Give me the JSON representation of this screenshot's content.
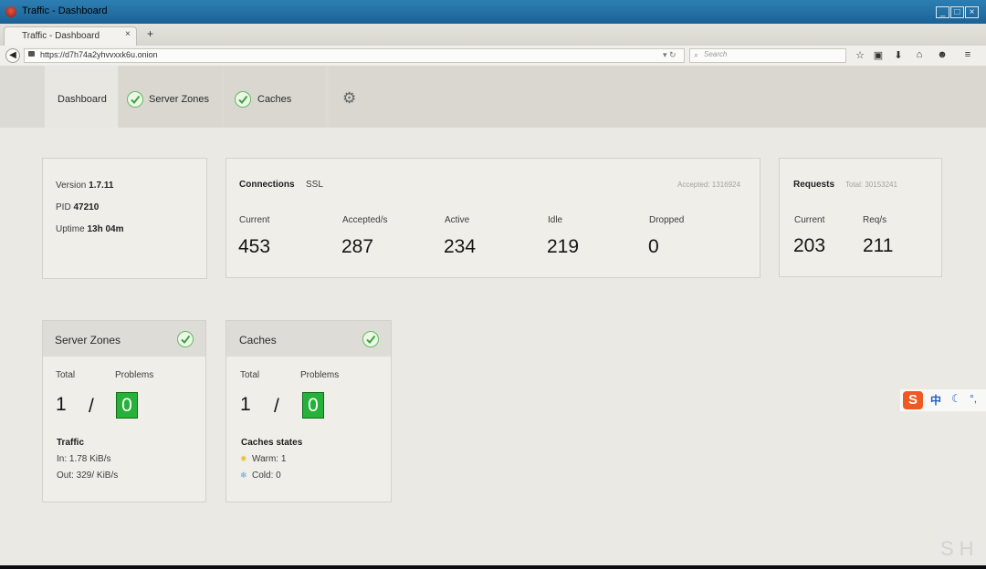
{
  "window": {
    "title": "Traffic - Dashboard"
  },
  "browser": {
    "tab_title": "Traffic - Dashboard",
    "close_glyph": "×",
    "new_tab_glyph": "+",
    "url": "https://d7h74a2yhvvxxk6u.onion",
    "search_placeholder": "Search"
  },
  "nav": {
    "tabs": [
      {
        "label": "Dashboard",
        "active": true
      },
      {
        "label": "Server Zones",
        "status": "ok"
      },
      {
        "label": "Caches",
        "status": "ok"
      }
    ]
  },
  "info": {
    "version_label": "Version",
    "version_value": "1.7.11",
    "pid_label": "PID",
    "pid_value": "47210",
    "uptime_label": "Uptime",
    "uptime_value": "13h 04m"
  },
  "connections": {
    "title": "Connections",
    "ssl_label": "SSL",
    "accepted_total": "Accepted: 1316924",
    "metrics": [
      {
        "label": "Current",
        "value": "453"
      },
      {
        "label": "Accepted/s",
        "value": "287"
      },
      {
        "label": "Active",
        "value": "234"
      },
      {
        "label": "Idle",
        "value": "219"
      },
      {
        "label": "Dropped",
        "value": "0"
      }
    ]
  },
  "requests": {
    "title": "Requests",
    "total": "Total: 30153241",
    "metrics": [
      {
        "label": "Current",
        "value": "203"
      },
      {
        "label": "Req/s",
        "value": "211"
      }
    ]
  },
  "server_zones": {
    "title": "Server Zones",
    "total_label": "Total",
    "problems_label": "Problems",
    "total": "1",
    "separator": "/",
    "problems": "0",
    "traffic_title": "Traffic",
    "traffic_in": "In: 1.78 KiB/s",
    "traffic_out": "Out: 329/ KiB/s"
  },
  "caches": {
    "title": "Caches",
    "total_label": "Total",
    "problems_label": "Problems",
    "total": "1",
    "separator": "/",
    "problems": "0",
    "states_title": "Caches states",
    "warm": "Warm: 1",
    "cold": "Cold: 0"
  },
  "ime": {
    "label": "中"
  },
  "watermark": "SH",
  "colors": {
    "ok_green": "#28b13a",
    "titlebar": "#2c7fb3",
    "ime_orange": "#f05a22"
  },
  "icons": [
    "back-arrow-icon",
    "lock-icon",
    "search-icon",
    "star-icon",
    "clipboard-icon",
    "download-icon",
    "home-icon",
    "smile-icon",
    "menu-icon",
    "gear-icon",
    "checkmark-icon",
    "sun-icon",
    "snowflake-icon"
  ]
}
